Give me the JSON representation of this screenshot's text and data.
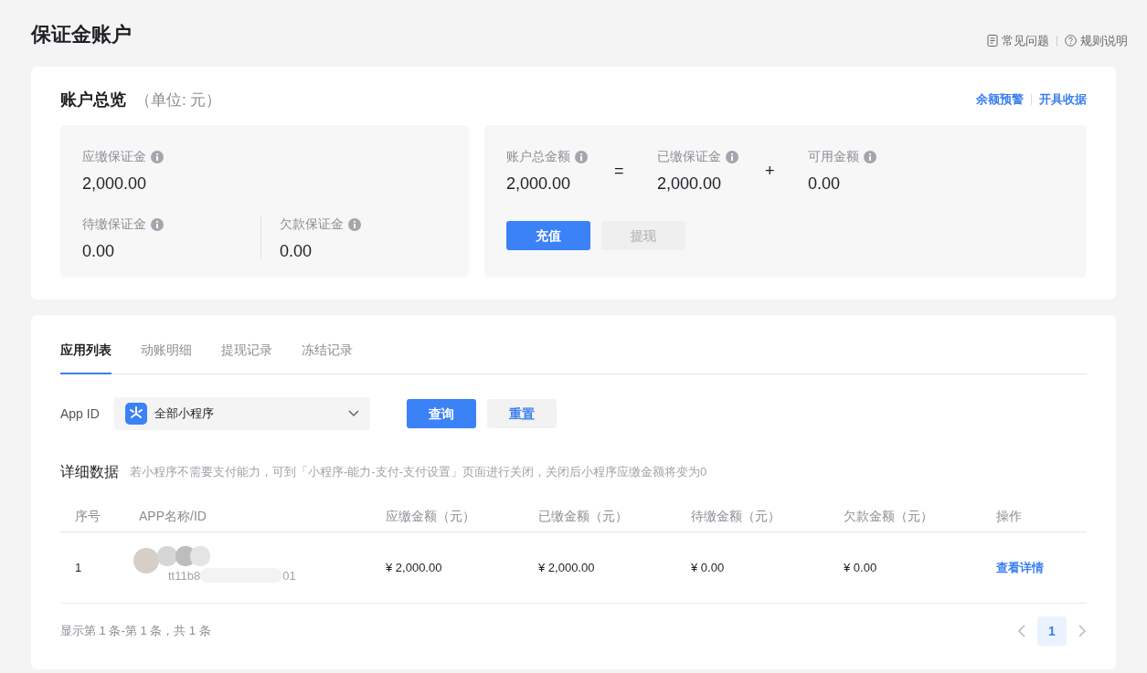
{
  "page_title": "保证金账户",
  "header_links": [
    {
      "kind": "doc",
      "label": "常见问题"
    },
    {
      "kind": "help",
      "label": "规则说明"
    }
  ],
  "overview": {
    "title": "账户总览",
    "unit": "（单位: 元）",
    "actions": [
      "余额预警",
      "开具收据"
    ],
    "due": {
      "label": "应缴保证金",
      "value": "2,000.00"
    },
    "pending": {
      "label": "待缴保证金",
      "value": "0.00"
    },
    "owed": {
      "label": "欠款保证金",
      "value": "0.00"
    },
    "equation": [
      {
        "kind": "item",
        "label": "账户总金额",
        "value": "2,000.00"
      },
      {
        "kind": "op",
        "symbol": "="
      },
      {
        "kind": "item",
        "label": "已缴保证金",
        "value": "2,000.00"
      },
      {
        "kind": "op",
        "symbol": "+"
      },
      {
        "kind": "item",
        "label": "可用金额",
        "value": "0.00"
      }
    ],
    "buttons": [
      {
        "label": "充值",
        "disabled": false
      },
      {
        "label": "提现",
        "disabled": true
      }
    ]
  },
  "tabs": [
    {
      "label": "应用列表",
      "selected": true
    },
    {
      "label": "动账明细",
      "selected": false
    },
    {
      "label": "提现记录",
      "selected": false
    },
    {
      "label": "冻结记录",
      "selected": false
    }
  ],
  "filter": {
    "label": "App ID",
    "value": "全部小程序",
    "buttons": [
      {
        "kind": "primary",
        "label": "查询"
      },
      {
        "kind": "secondary",
        "label": "重置"
      }
    ]
  },
  "detail": {
    "title": "详细数据",
    "note": "若小程序不需要支付能力，可到「小程序-能力-支付-支付设置」页面进行关闭，关闭后小程序应缴金额将变为0"
  },
  "table": {
    "columns": [
      "序号",
      "APP名称/ID",
      "应缴金额（元）",
      "已缴金额（元）",
      "待缴金额（元）",
      "欠款金额（元）",
      "操作"
    ],
    "rows": [
      {
        "index": "1",
        "app_id_start": "tt11b8",
        "app_id_end": "01",
        "due": "¥ 2,000.00",
        "paid": "¥ 2,000.00",
        "pending": "¥ 0.00",
        "owed": "¥ 0.00",
        "action": "查看详情"
      }
    ]
  },
  "pagination": {
    "summary": "显示第 1 条-第 1 条，共 1 条",
    "pages": [
      {
        "label": "1",
        "selected": true
      }
    ]
  }
}
